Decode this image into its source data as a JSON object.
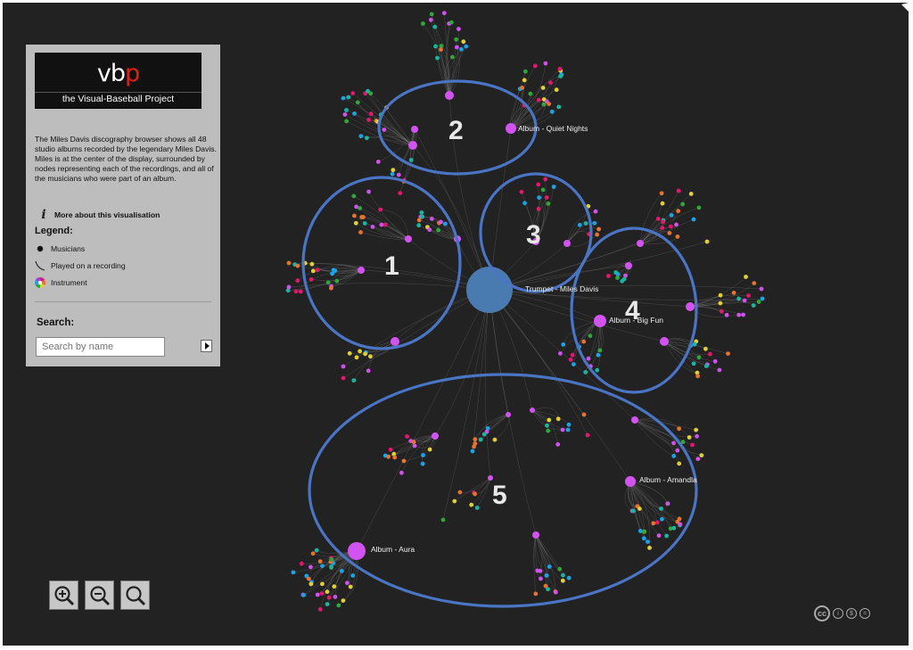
{
  "logo": {
    "mark_prefix": "vb",
    "mark_accent": "p",
    "subtitle": "the Visual-Baseball Project"
  },
  "panel": {
    "description": "The Miles Davis discography browser shows all 48 studio albums recorded by the legendary Miles Davis. Miles is at the center of the display, surrounded by nodes representing each of the recordings, and all of the musicians who were part of an album.",
    "more_link": "More about this visualisation",
    "legend_title": "Legend:",
    "legend": [
      {
        "label": "Musicians",
        "icon": "dot-icon"
      },
      {
        "label": "Played on a recording",
        "icon": "curve-icon"
      },
      {
        "label": "Instrument",
        "icon": "color-wheel-icon"
      }
    ],
    "search_title": "Search:",
    "search_placeholder": "Search by name"
  },
  "graph": {
    "center_label": "Trumpet - Miles Davis",
    "album_labels": [
      "Album - Quiet Nights",
      "Album - Big Fun",
      "Album - Amandla",
      "Album - Aura"
    ],
    "annotations": [
      "1",
      "2",
      "3",
      "4",
      "5"
    ],
    "colors": {
      "center": "#4a7bb0",
      "album": "#d253f2",
      "highlight": "#4a74c4",
      "edge": "#8a8a8a",
      "musicians": [
        "#e5166e",
        "#19a4e8",
        "#2fa83a",
        "#e8732a",
        "#d251ee",
        "#e0d030",
        "#17b6a3"
      ]
    }
  },
  "controls": {
    "zoom_in": "zoom-in-icon",
    "zoom_out": "zoom-out-icon",
    "zoom_reset": "zoom-icon"
  },
  "license": {
    "cc": "cc"
  }
}
